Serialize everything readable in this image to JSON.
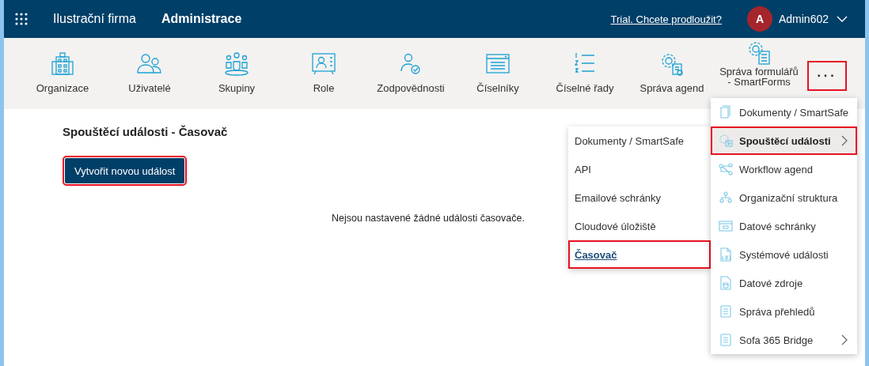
{
  "header": {
    "company": "Ilustrační firma",
    "section": "Administrace",
    "trial_link": "Trial. Chcete prodloužit?",
    "avatar": "A",
    "user": "Admin602"
  },
  "toolbar": {
    "items": [
      {
        "label": "Organizace"
      },
      {
        "label": "Uživatelé"
      },
      {
        "label": "Skupiny"
      },
      {
        "label": "Role"
      },
      {
        "label": "Zodpovědnosti"
      },
      {
        "label": "Číselníky"
      },
      {
        "label": "Číselné řady"
      },
      {
        "label": "Správa agend"
      },
      {
        "label": "Správa formulářů - SmartForms"
      }
    ],
    "more_button": {
      "label": "···",
      "highlighted": true
    }
  },
  "page": {
    "title": "Spouštěcí události - Časovač",
    "create_button": {
      "label": "Vytvořit novou událost",
      "highlighted": true
    },
    "empty_message": "Nejsou nastavené žádné události časovače."
  },
  "menu": {
    "items": [
      {
        "label": "Dokumenty / SmartSafe",
        "selected": false,
        "highlighted": false,
        "submenu": false
      },
      {
        "label": "Spouštěcí události",
        "selected": true,
        "highlighted": true,
        "submenu": true
      },
      {
        "label": "Workflow agend",
        "selected": false,
        "highlighted": false,
        "submenu": false
      },
      {
        "label": "Organizační struktura",
        "selected": false,
        "highlighted": false,
        "submenu": false
      },
      {
        "label": "Datové schránky",
        "selected": false,
        "highlighted": false,
        "submenu": false
      },
      {
        "label": "Systémové události",
        "selected": false,
        "highlighted": false,
        "submenu": false
      },
      {
        "label": "Datové zdroje",
        "selected": false,
        "highlighted": false,
        "submenu": false
      },
      {
        "label": "Správa přehledů",
        "selected": false,
        "highlighted": false,
        "submenu": false
      },
      {
        "label": "Sofa 365 Bridge",
        "selected": false,
        "highlighted": false,
        "submenu": true
      }
    ]
  },
  "submenu": {
    "items": [
      {
        "label": "Dokumenty / SmartSafe",
        "selected": false,
        "highlighted": false
      },
      {
        "label": "API",
        "selected": false,
        "highlighted": false
      },
      {
        "label": "Emailové schránky",
        "selected": false,
        "highlighted": false
      },
      {
        "label": "Cloudové úložiště",
        "selected": false,
        "highlighted": false
      },
      {
        "label": "Časovač",
        "selected": true,
        "highlighted": true
      }
    ]
  }
}
